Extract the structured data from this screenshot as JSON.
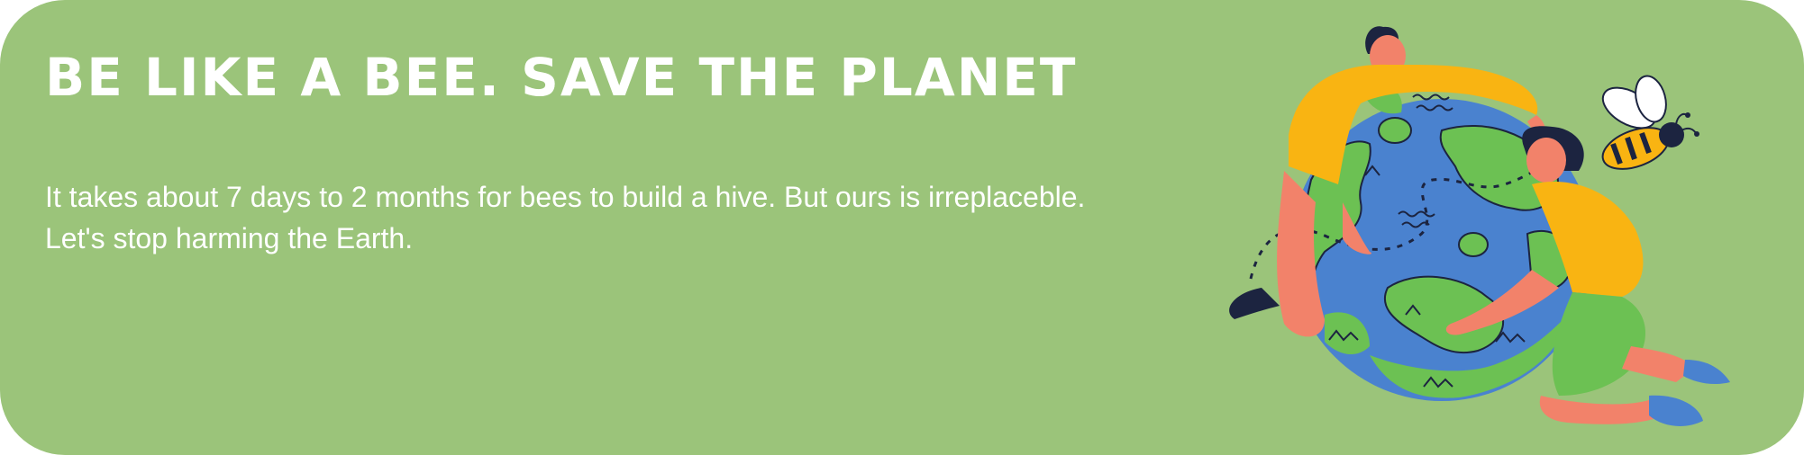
{
  "banner": {
    "title": "BE LIKE A BEE. SAVE THE PLANET",
    "body_lines": [
      "It takes about 7 days to 2 months for bees to build a hive. But ours is irreplaceble.",
      "Let's stop harming the Earth."
    ],
    "colors": {
      "background": "#9bc47a",
      "text": "#ffffff",
      "ocean": "#4a82cf",
      "land": "#6cc153",
      "shirt": "#f9b412",
      "skin": "#f2826a",
      "shoe": "#4a82cf",
      "bee_stripe": "#f9b412"
    },
    "illustration": {
      "icons": [
        "earth-globe-icon",
        "bee-icon",
        "person-hugging-icon"
      ]
    }
  }
}
